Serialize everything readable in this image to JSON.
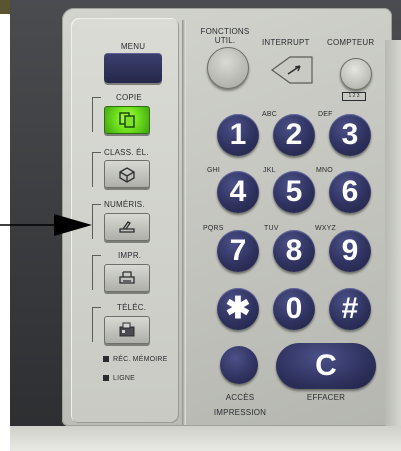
{
  "panel": {
    "menu_label": "MENU",
    "modes": [
      {
        "label": "COPIE",
        "icon": "copy-icon",
        "lit": true
      },
      {
        "label": "CLASS. ÉL.",
        "icon": "box-icon",
        "lit": false
      },
      {
        "label": "NUMÉRIS.",
        "icon": "scanner-icon",
        "lit": false
      },
      {
        "label": "IMPR.",
        "icon": "printer-icon",
        "lit": false
      },
      {
        "label": "TÉLÉC.",
        "icon": "fax-icon",
        "lit": false
      }
    ],
    "indicators": [
      {
        "label": "RÉC. MÉMOIRE"
      },
      {
        "label": "LIGNE"
      }
    ],
    "functions": {
      "fonctions_label_line1": "FONCTIONS",
      "fonctions_label_line2": "UTIL.",
      "interrupt_label": "INTERRUPT",
      "compteur_label": "COMPTEUR",
      "compteur_sub": "1 2 3"
    },
    "keypad": [
      {
        "digit": "1",
        "letters": ""
      },
      {
        "digit": "2",
        "letters": "ABC"
      },
      {
        "digit": "3",
        "letters": "DEF"
      },
      {
        "digit": "4",
        "letters": "GHI"
      },
      {
        "digit": "5",
        "letters": "JKL"
      },
      {
        "digit": "6",
        "letters": "MNO"
      },
      {
        "digit": "7",
        "letters": "PQRS"
      },
      {
        "digit": "8",
        "letters": "TUV"
      },
      {
        "digit": "9",
        "letters": "WXYZ"
      },
      {
        "digit": "✱",
        "letters": ""
      },
      {
        "digit": "0",
        "letters": ""
      },
      {
        "digit": "#",
        "letters": ""
      }
    ],
    "acces_label_line1": "ACCÈS",
    "acces_label_line2": "IMPRESSION",
    "clear_key": "C",
    "clear_label": "EFFACER"
  },
  "colors": {
    "panel": "#c8c9c3",
    "key_blue": "#2f325e",
    "copy_led": "#6fe01c",
    "arrow": "#000000"
  }
}
